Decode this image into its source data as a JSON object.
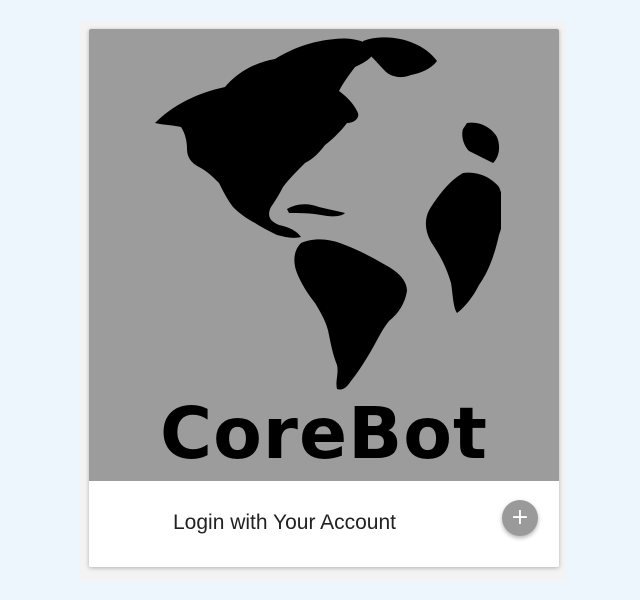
{
  "card": {
    "brand_name": "CoreBot",
    "logo_icon": "globe-americas-icon",
    "action_label": "Login with Your Account",
    "fab_icon": "plus-icon",
    "fab_symbol": "+"
  },
  "colors": {
    "page_background": "#eef6fd",
    "media_background": "#9c9c9c",
    "card_background": "#ffffff",
    "fab_background": "#9a9a9a",
    "text": "#222222"
  }
}
